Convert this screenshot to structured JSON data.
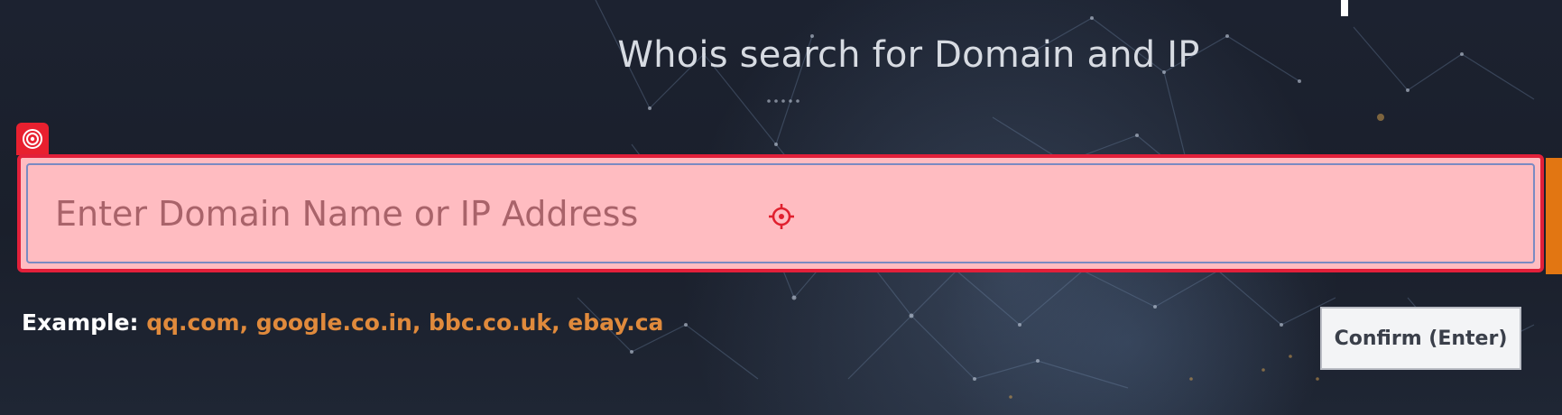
{
  "header": {
    "title": "Whois search for Domain and IP"
  },
  "search": {
    "placeholder": "Enter Domain Name or IP Address",
    "value": ""
  },
  "examples": {
    "label": "Example:",
    "items": [
      "qq.com",
      "google.co.in",
      "bbc.co.uk",
      "ebay.ca"
    ],
    "separator": ", "
  },
  "actions": {
    "confirm_label": "Confirm (Enter)"
  },
  "icons": {
    "target_badge": "target-icon",
    "crosshair": "crosshair-icon"
  },
  "colors": {
    "highlight_border": "#e2203a",
    "highlight_fill": "#ffbcc1",
    "example_link": "#e08a3c",
    "accent_orange": "#e27612",
    "background": "#1c2230"
  }
}
